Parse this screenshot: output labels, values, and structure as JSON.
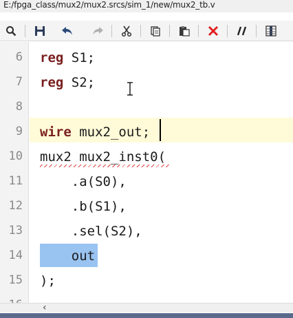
{
  "window": {
    "file_path": "E:/fpga_class/mux2/mux2.srcs/sim_1/new/mux2_tb.v"
  },
  "toolbar": {
    "buttons": [
      {
        "icon": "search-icon"
      },
      {
        "icon": "save-icon"
      },
      {
        "icon": "undo-icon"
      },
      {
        "icon": "redo-icon"
      },
      {
        "icon": "cut-icon"
      },
      {
        "icon": "copy-icon"
      },
      {
        "icon": "paste-icon"
      },
      {
        "icon": "delete-icon"
      },
      {
        "icon": "comment-icon"
      },
      {
        "icon": "column-select-icon"
      }
    ]
  },
  "editor": {
    "line_numbers": [
      "6",
      "7",
      "8",
      "9",
      "10",
      "11",
      "12",
      "13",
      "14",
      "15",
      "16"
    ],
    "lines": {
      "l6": {
        "keyword": "reg",
        "rest": " S1;"
      },
      "l7": {
        "keyword": "reg",
        "rest": " S2;"
      },
      "l8": {
        "text": ""
      },
      "l9": {
        "keyword": "wire",
        "rest": " mux2_out;"
      },
      "l10": {
        "text": "mux2 mux2_inst0("
      },
      "l11": {
        "text": "    .a(S0),"
      },
      "l12": {
        "text": "    .b(S1),"
      },
      "l13": {
        "text": "    .sel(S2),"
      },
      "l14": {
        "text": "    out"
      },
      "l15": {
        "text": ");"
      }
    },
    "selected_text": "out",
    "current_line": "9"
  },
  "colors": {
    "keyword": "#7a1f1f",
    "selection": "#99c3f0",
    "current_line_highlight": "#fffbd8",
    "undo_enabled": "#2b4a7a",
    "redo_disabled": "#b0b0b0",
    "delete_red": "#e02020"
  }
}
